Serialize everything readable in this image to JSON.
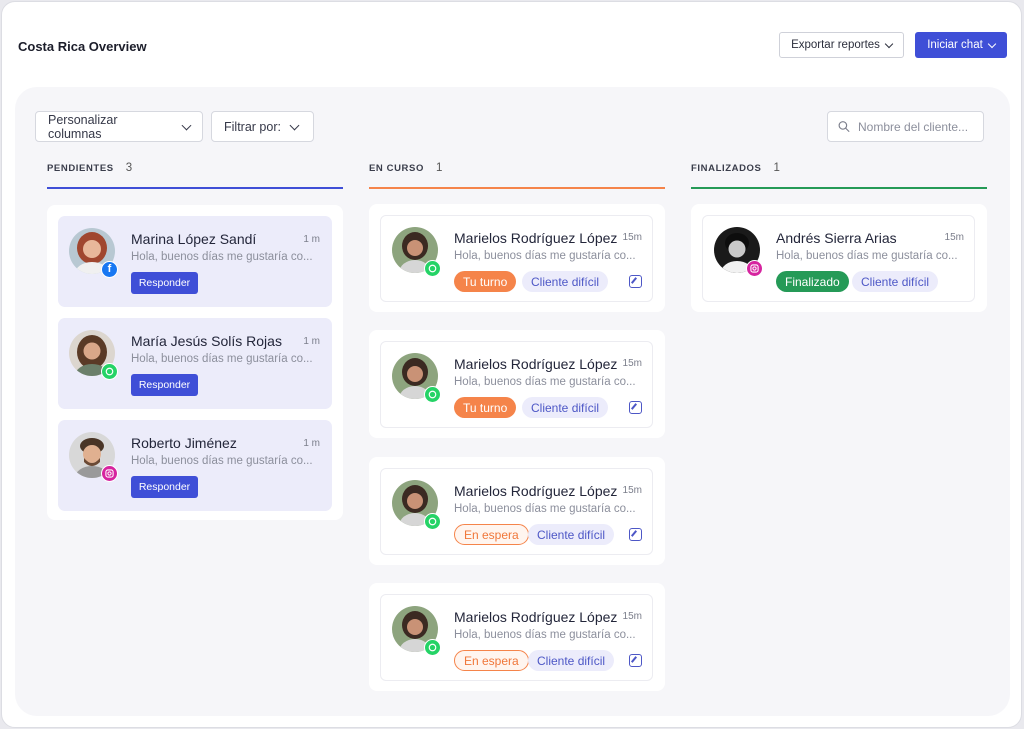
{
  "header": {
    "title": "Costa Rica Overview",
    "export_label": "Exportar reportes",
    "chat_label": "Iniciar chat"
  },
  "toolbar": {
    "customize_label": "Personalizar columnas",
    "filter_label": "Filtrar por:",
    "search_placeholder": "Nombre del cliente..."
  },
  "colors": {
    "accent": "#3f4fd7",
    "pending_line": "#3f4fd7",
    "inprogress_line": "#f5844a",
    "done_line": "#259a57"
  },
  "columns": [
    {
      "title": "PENDIENTES",
      "count": "3"
    },
    {
      "title": "EN CURSO",
      "count": "1"
    },
    {
      "title": "FINALIZADOS",
      "count": "1"
    }
  ],
  "pending": [
    {
      "name": "Marina López Sandí",
      "time": "1 m",
      "message": "Hola, buenos días me gustaría co...",
      "action": "Responder",
      "channel": "facebook-icon"
    },
    {
      "name": "María Jesús Solís Rojas",
      "time": "1 m",
      "message": "Hola, buenos días me gustaría co...",
      "action": "Responder",
      "channel": "whatsapp-icon"
    },
    {
      "name": "Roberto Jiménez",
      "time": "1 m",
      "message": "Hola, buenos días me gustaría co...",
      "action": "Responder",
      "channel": "instagram-icon"
    }
  ],
  "in_progress": [
    {
      "name": "Marielos Rodríguez López",
      "time": "15m",
      "message": "Hola, buenos días me gustaría co...",
      "status": "Tu turno",
      "tag": "Cliente difícil",
      "channel": "whatsapp-icon"
    },
    {
      "name": "Marielos Rodríguez López",
      "time": "15m",
      "message": "Hola, buenos días me gustaría co...",
      "status": "Tu turno",
      "tag": "Cliente difícil",
      "channel": "whatsapp-icon"
    },
    {
      "name": "Marielos Rodríguez López",
      "time": "15m",
      "message": "Hola, buenos días me gustaría co...",
      "status": "En espera",
      "tag": "Cliente difícil",
      "channel": "whatsapp-icon"
    },
    {
      "name": "Marielos Rodríguez López",
      "time": "15m",
      "message": "Hola, buenos días me gustaría co...",
      "status": "En espera",
      "tag": "Cliente difícil",
      "channel": "whatsapp-icon"
    }
  ],
  "done": [
    {
      "name": "Andrés Sierra Arias",
      "time": "15m",
      "message": "Hola, buenos días me gustaría co...",
      "status": "Finalizado",
      "tag": "Cliente difícil",
      "channel": "instagram-icon"
    }
  ]
}
